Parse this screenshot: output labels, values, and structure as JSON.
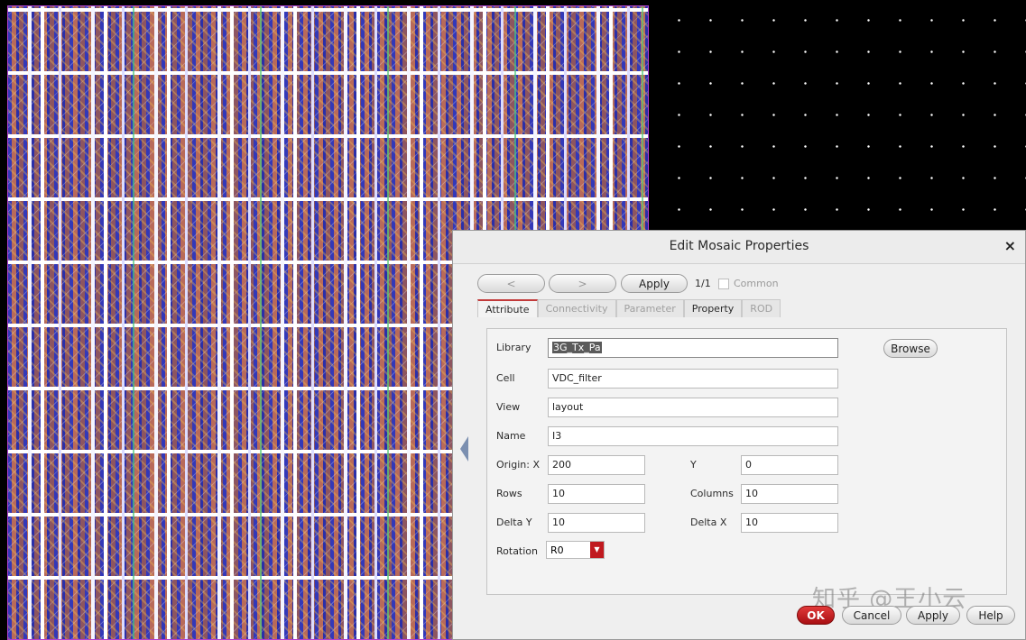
{
  "dialog": {
    "title": "Edit Mosaic Properties",
    "close_label": "×",
    "nav": {
      "prev_label": "<",
      "next_label": ">",
      "apply_label": "Apply",
      "counter": "1/1",
      "common_label": "Common"
    },
    "tabs": [
      "Attribute",
      "Connectivity",
      "Parameter",
      "Property",
      "ROD"
    ],
    "fields": {
      "library_label": "Library",
      "library_value": "3G_Tx_Pa",
      "browse_label": "Browse",
      "cell_label": "Cell",
      "cell_value": "VDC_filter",
      "view_label": "View",
      "view_value": "layout",
      "name_label": "Name",
      "name_value": "I3",
      "origin_x_label": "Origin: X",
      "origin_x_value": "200",
      "origin_y_label": "Y",
      "origin_y_value": "0",
      "rows_label": "Rows",
      "rows_value": "10",
      "columns_label": "Columns",
      "columns_value": "10",
      "delta_y_label": "Delta Y",
      "delta_y_value": "10",
      "delta_x_label": "Delta X",
      "delta_x_value": "10",
      "rotation_label": "Rotation",
      "rotation_value": "R0"
    },
    "footer": {
      "ok_label": "OK",
      "cancel_label": "Cancel",
      "apply_label": "Apply",
      "help_label": "Help"
    }
  },
  "watermark": "知乎 @王小云",
  "colors": {
    "ok_button": "#c0191f",
    "active_tab_accent": "#c23a3a",
    "canvas_bg": "#000000"
  }
}
